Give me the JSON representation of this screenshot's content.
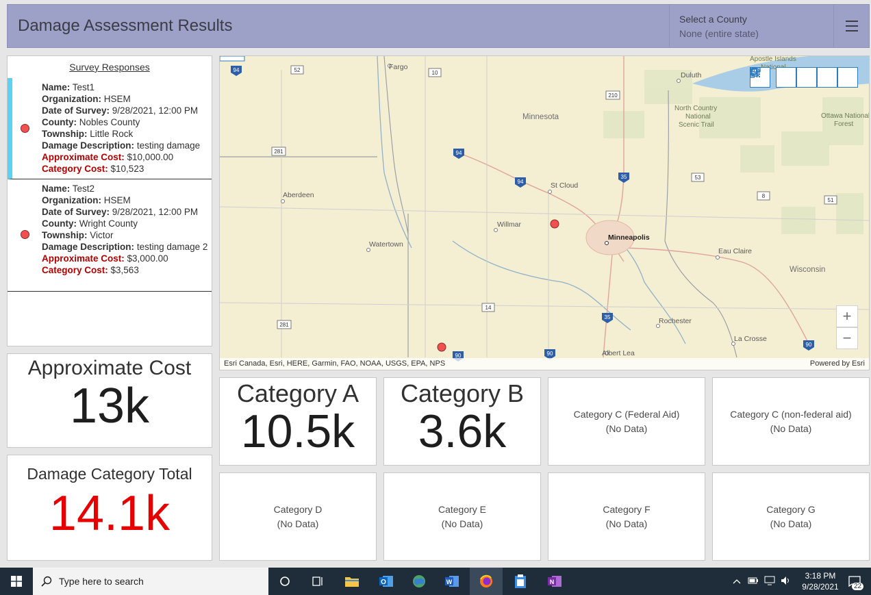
{
  "header": {
    "title": "Damage Assessment Results",
    "county_label": "Select a County",
    "county_value": "None (entire state)"
  },
  "list": {
    "title": "Survey Responses",
    "items": [
      {
        "name_label": "Name:",
        "name": "Test1",
        "org_label": "Organization:",
        "org": "HSEM",
        "date_label": "Date of Survey:",
        "date": "9/28/2021, 12:00 PM",
        "county_label": "County:",
        "county": "Nobles County",
        "township_label": "Township:",
        "township": "Little Rock",
        "desc_label": "Damage Description:",
        "desc": "testing damage",
        "approx_label": "Approximate Cost:",
        "approx": "$10,000.00",
        "cat_label": "Category Cost:",
        "cat": "$10,523"
      },
      {
        "name_label": "Name:",
        "name": "Test2",
        "org_label": "Organization:",
        "org": "HSEM",
        "date_label": "Date of Survey:",
        "date": "9/28/2021, 12:00 PM",
        "county_label": "County:",
        "county": "Wright County",
        "township_label": "Township:",
        "township": "Victor",
        "desc_label": "Damage Description:",
        "desc": "testing damage 2",
        "approx_label": "Approximate Cost:",
        "approx": "$3,000.00",
        "cat_label": "Category Cost:",
        "cat": "$3,563"
      }
    ]
  },
  "map": {
    "labels": {
      "fargo": "Fargo",
      "duluth": "Duluth",
      "minnesota": "Minnesota",
      "nct": "North Country",
      "nct2": "National",
      "nct3": "Scenic Trail",
      "ottawa": "Ottawa National",
      "ottawa2": "Forest",
      "apostle": "Apostle Islands",
      "apostle2": "National",
      "aberdeen": "Aberdeen",
      "stcloud": "St Cloud",
      "willmar": "Willmar",
      "watertown": "Watertown",
      "minneapolis": "Minneapolis",
      "eauclaire": "Eau Claire",
      "wisconsin": "Wisconsin",
      "rochester": "Rochester",
      "lacrosse": "La Crosse",
      "albertlea": "Albert Lea"
    },
    "shields": [
      "94",
      "52",
      "10",
      "210",
      "281",
      "94",
      "94",
      "35",
      "53",
      "8",
      "51",
      "281",
      "14",
      "35",
      "90",
      "90",
      "90"
    ],
    "attribution": "Esri Canada, Esri, HERE, Garmin, FAO, NOAA, USGS, EPA, NPS",
    "powered": "Powered by Esri",
    "zoom_in": "+",
    "zoom_out": "−"
  },
  "kpis": {
    "approx_title": "Approximate Cost",
    "approx_value": "13k",
    "dmg_title": "Damage Category Total",
    "dmg_value": "14.1k"
  },
  "categories": [
    {
      "title": "Category A",
      "value": "10.5k"
    },
    {
      "title": "Category B",
      "value": "3.6k"
    },
    {
      "title": "Category C (Federal Aid)",
      "value": "(No Data)"
    },
    {
      "title": "Category C (non-federal aid)",
      "value": "(No Data)"
    },
    {
      "title": "Category D",
      "value": "(No Data)"
    },
    {
      "title": "Category E",
      "value": "(No Data)"
    },
    {
      "title": "Category F",
      "value": "(No Data)"
    },
    {
      "title": "Category G",
      "value": "(No Data)"
    }
  ],
  "taskbar": {
    "search_placeholder": "Type here to search",
    "time": "3:18 PM",
    "date": "9/28/2021",
    "notifications": "22"
  },
  "colors": {
    "header_bg": "#9da1c8",
    "selected_accent": "#5bd1f3",
    "point": "#f05050",
    "cost_red": "#b10000",
    "total_red": "#e60000"
  }
}
